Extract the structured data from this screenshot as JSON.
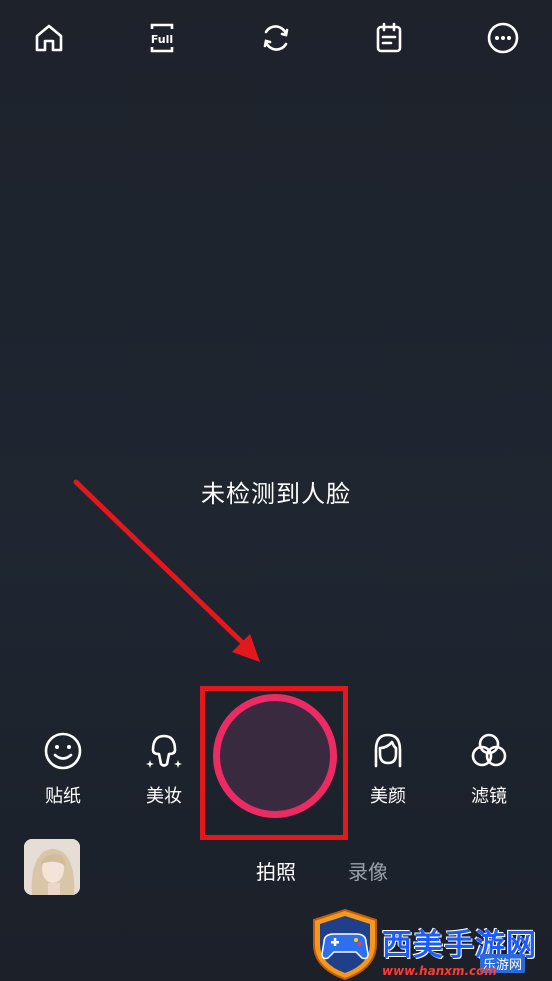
{
  "top_bar": {
    "home_icon": "home-icon",
    "full_label": "Full",
    "rotate_icon": "rotate-icon",
    "notes_icon": "notes-icon",
    "more_icon": "more-icon"
  },
  "hint_text": "未检测到人脸",
  "tools": [
    {
      "label": "贴纸",
      "icon": "smiley-icon"
    },
    {
      "label": "美妆",
      "icon": "makeup-icon"
    },
    {
      "label": "美颜",
      "icon": "face-beauty-icon"
    },
    {
      "label": "滤镜",
      "icon": "filter-icon"
    }
  ],
  "modes": {
    "photo": "拍照",
    "video": "录像"
  },
  "watermark": {
    "title": "西美手游网",
    "sub": "乐游网",
    "url": "www.hanxm.com"
  },
  "colors": {
    "shutter_ring": "#ec2a64",
    "highlight": "#e3181d",
    "arrow": "#e3181d"
  }
}
